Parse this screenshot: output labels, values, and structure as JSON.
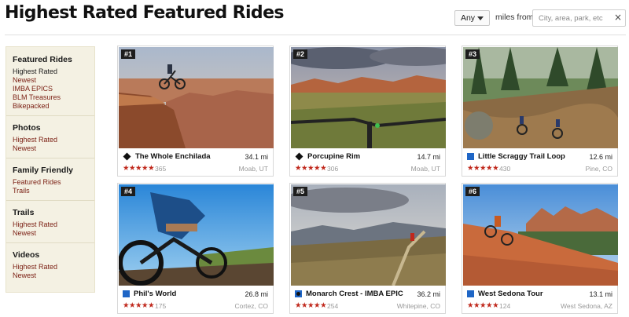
{
  "header": {
    "title": "Highest Rated Featured Rides",
    "distance_select": "Any",
    "miles_label": "miles from",
    "search_placeholder": "City, area, park, etc",
    "clear": "×"
  },
  "sidebar": [
    {
      "heading": "Featured Rides",
      "links": [
        "Highest Rated",
        "Newest",
        "IMBA EPICS",
        "BLM Treasures",
        "Bikepacked"
      ]
    },
    {
      "heading": "Photos",
      "links": [
        "Highest Rated",
        "Newest"
      ]
    },
    {
      "heading": "Family Friendly",
      "links": [
        "Featured Rides",
        "Trails"
      ]
    },
    {
      "heading": "Trails",
      "links": [
        "Highest Rated",
        "Newest"
      ]
    },
    {
      "heading": "Videos",
      "links": [
        "Highest Rated",
        "Newest"
      ]
    }
  ],
  "rides": [
    {
      "rank": "#1",
      "name": "The Whole Enchilada",
      "difficulty_icon": "black-diamond-icon",
      "distance": "34.1 mi",
      "stars": "★★★★★",
      "rating": 5,
      "reviews": "365",
      "location": "Moab, UT"
    },
    {
      "rank": "#2",
      "name": "Porcupine Rim",
      "difficulty_icon": "black-diamond-icon",
      "distance": "14.7 mi",
      "stars": "★★★★★",
      "rating": 5,
      "reviews": "306",
      "location": "Moab, UT"
    },
    {
      "rank": "#3",
      "name": "Little Scraggy Trail Loop",
      "difficulty_icon": "blue-square-icon",
      "distance": "12.6 mi",
      "stars": "★★★★★",
      "rating": 4.5,
      "reviews": "430",
      "location": "Pine, CO"
    },
    {
      "rank": "#4",
      "name": "Phil's World",
      "difficulty_icon": "blue-square-icon",
      "distance": "26.8 mi",
      "stars": "★★★★★",
      "rating": 4.5,
      "reviews": "175",
      "location": "Cortez, CO"
    },
    {
      "rank": "#5",
      "name": "Monarch Crest - IMBA EPIC",
      "difficulty_icon": "blue-black-icon",
      "distance": "36.2 mi",
      "stars": "★★★★★",
      "rating": 4.5,
      "reviews": "254",
      "location": "Whitepine, CO"
    },
    {
      "rank": "#6",
      "name": "West Sedona Tour",
      "difficulty_icon": "blue-square-icon",
      "distance": "13.1 mi",
      "stars": "★★★★★",
      "rating": 4.5,
      "reviews": "124",
      "location": "West Sedona, AZ"
    }
  ],
  "colors": {
    "link": "#7a1e12",
    "stars": "#c0281c",
    "sidebar_bg": "#f4f1e3",
    "blue_square": "#1f66c6"
  }
}
